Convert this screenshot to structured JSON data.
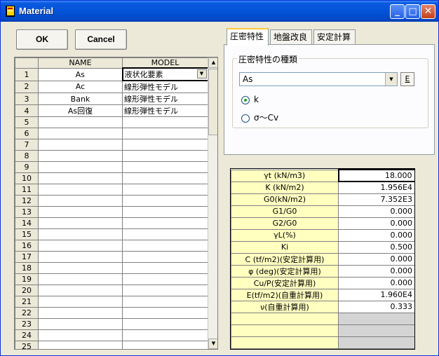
{
  "window": {
    "title": "Material"
  },
  "toolbar": {
    "ok_label": "OK",
    "cancel_label": "Cancel"
  },
  "grid": {
    "columns": [
      "NAME",
      "MODEL"
    ],
    "rows": [
      {
        "n": "1",
        "name": "As",
        "model": "液状化要素"
      },
      {
        "n": "2",
        "name": "Ac",
        "model": "線形弾性モデル"
      },
      {
        "n": "3",
        "name": "Bank",
        "model": "線形弾性モデル"
      },
      {
        "n": "4",
        "name": "As回復",
        "model": "線形弾性モデル"
      },
      {
        "n": "5",
        "name": "",
        "model": ""
      },
      {
        "n": "6",
        "name": "",
        "model": ""
      },
      {
        "n": "7",
        "name": "",
        "model": ""
      },
      {
        "n": "8",
        "name": "",
        "model": ""
      },
      {
        "n": "9",
        "name": "",
        "model": ""
      },
      {
        "n": "10",
        "name": "",
        "model": ""
      },
      {
        "n": "11",
        "name": "",
        "model": ""
      },
      {
        "n": "12",
        "name": "",
        "model": ""
      },
      {
        "n": "13",
        "name": "",
        "model": ""
      },
      {
        "n": "14",
        "name": "",
        "model": ""
      },
      {
        "n": "15",
        "name": "",
        "model": ""
      },
      {
        "n": "16",
        "name": "",
        "model": ""
      },
      {
        "n": "17",
        "name": "",
        "model": ""
      },
      {
        "n": "18",
        "name": "",
        "model": ""
      },
      {
        "n": "19",
        "name": "",
        "model": ""
      },
      {
        "n": "20",
        "name": "",
        "model": ""
      },
      {
        "n": "21",
        "name": "",
        "model": ""
      },
      {
        "n": "22",
        "name": "",
        "model": ""
      },
      {
        "n": "23",
        "name": "",
        "model": ""
      },
      {
        "n": "24",
        "name": "",
        "model": ""
      },
      {
        "n": "25",
        "name": "",
        "model": ""
      }
    ]
  },
  "tabs": [
    {
      "label": "圧密特性"
    },
    {
      "label": "地盤改良"
    },
    {
      "label": "安定計算"
    }
  ],
  "consolidation": {
    "group_title": "圧密特性の種類",
    "combo_value": "As",
    "e_button": "E",
    "radio_k": "k",
    "radio_sigma": "σ～Cv"
  },
  "properties": [
    {
      "label": "γt (kN/m3)",
      "value": "18.000"
    },
    {
      "label": "K (kN/m2)",
      "value": "1.956E4"
    },
    {
      "label": "G0(kN/m2)",
      "value": "7.352E3"
    },
    {
      "label": "G1/G0",
      "value": "0.000"
    },
    {
      "label": "G2/G0",
      "value": "0.000"
    },
    {
      "label": "γL(%)",
      "value": "0.000"
    },
    {
      "label": "Ki",
      "value": "0.500"
    },
    {
      "label": "C (tf/m2)(安定計算用)",
      "value": "0.000"
    },
    {
      "label": "φ (deg)(安定計算用)",
      "value": "0.000"
    },
    {
      "label": "Cu/P(安定計算用)",
      "value": "0.000"
    },
    {
      "label": "E(tf/m2)(自重計算用)",
      "value": "1.960E4"
    },
    {
      "label": "ν(自重計算用)",
      "value": "0.333"
    },
    {
      "label": "",
      "value": ""
    },
    {
      "label": "",
      "value": ""
    },
    {
      "label": "",
      "value": ""
    }
  ]
}
